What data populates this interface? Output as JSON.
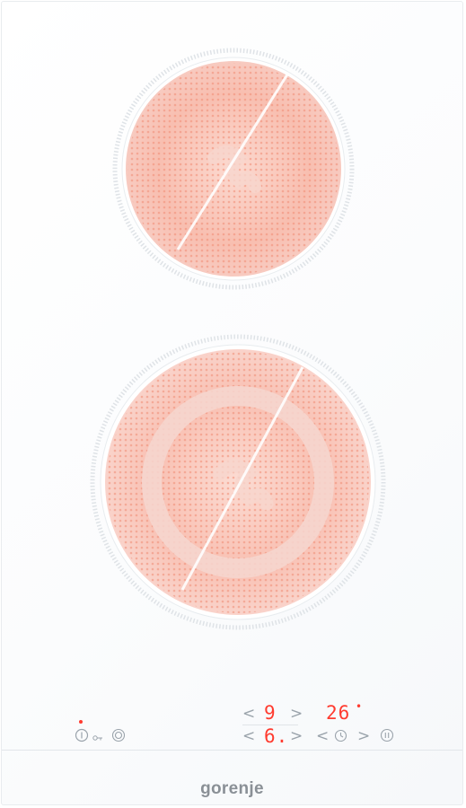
{
  "colors": {
    "heater": "#f4a08a",
    "display": "#ff3b2f",
    "icon": "#9aa3ab",
    "brand": "#8a9096"
  },
  "zones": [
    {
      "name": "top-cooking-zone"
    },
    {
      "name": "bottom-dual-cooking-zone"
    }
  ],
  "controls": {
    "power_icon": "power-icon",
    "key_icon": "key-lock-icon",
    "dual_zone_icon": "dual-zone-icon",
    "timer_icon": "clock-icon",
    "pause_icon": "pause-icon",
    "left_arrow": "<",
    "right_arrow": ">",
    "zone_top_level": "9",
    "zone_bottom_level": "6.",
    "timer_value": "26",
    "timer_dot": "•"
  },
  "brand": "gorenje"
}
